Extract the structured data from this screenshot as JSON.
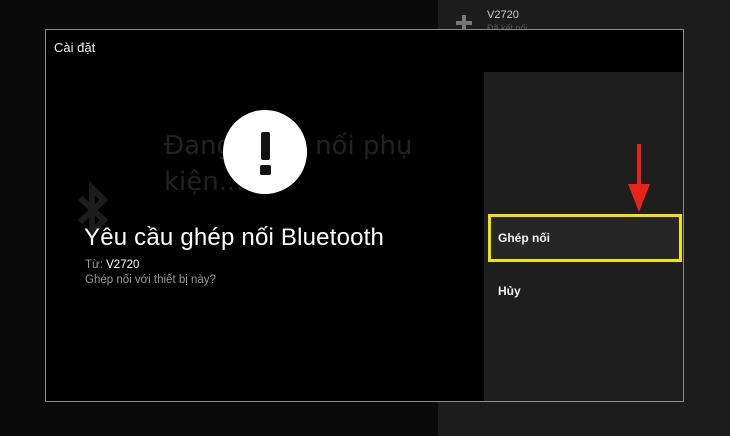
{
  "background": {
    "device_name": "V2720",
    "device_sub": "Đã kết nối"
  },
  "dialog": {
    "title": "Cài đặt",
    "ghost_text": "Đang ghép nối phụ\nkiện...",
    "heading": "Yêu cầu ghép nối Bluetooth",
    "from_label": "Từ:",
    "from_value": "V2720",
    "question": "Ghép nối với thiết bị này?"
  },
  "actions": {
    "pair_label": "Ghép nối",
    "cancel_label": "Hủy"
  },
  "icons": {
    "alert": "exclamation-icon",
    "gamepad": "gamepad-icon",
    "bluetooth": "bluetooth-icon",
    "annotation": "red-arrow-down-icon"
  },
  "colors": {
    "highlight": "#f4e200",
    "arrow": "#e8231a",
    "panel": "#1e1e1e"
  }
}
